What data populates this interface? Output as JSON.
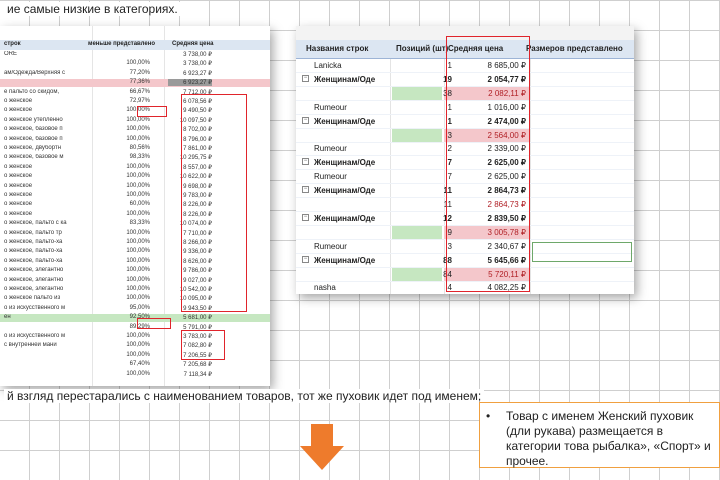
{
  "top_text": "ие самые низкие в категориях.",
  "left_table": {
    "headers": [
      "строк",
      "меньше представлено",
      "Средняя цена"
    ],
    "rows": [
      {
        "name": "ORE",
        "pct": "",
        "price": "3 738,00 ₽"
      },
      {
        "name": "",
        "pct": "100,00%",
        "price": "3 738,00 ₽"
      },
      {
        "name": "ам/Одежда/Верхняя с",
        "pct": "77,20%",
        "price": "6 923,27 ₽"
      },
      {
        "name": "",
        "pct": "77,36%",
        "price": "6 923,27 ₽"
      },
      {
        "name": "е пальто со скидом,",
        "pct": "66,67%",
        "price": "7 712,00 ₽"
      },
      {
        "name": "о женское",
        "pct": "72,97%",
        "price": "6 078,56 ₽"
      },
      {
        "name": "о женское",
        "pct": "100,00%",
        "price": "9 490,50 ₽"
      },
      {
        "name": "о женское утеплённо",
        "pct": "100,00%",
        "price": "10 097,50 ₽"
      },
      {
        "name": "о женское, базовое п",
        "pct": "100,00%",
        "price": "8 702,00 ₽"
      },
      {
        "name": "о женское, базовое п",
        "pct": "100,00%",
        "price": "8 796,00 ₽"
      },
      {
        "name": "о женское, двубортн",
        "pct": "80,56%",
        "price": "7 861,00 ₽"
      },
      {
        "name": "о женское, базовое м",
        "pct": "98,33%",
        "price": "10 295,75 ₽"
      },
      {
        "name": "о женское",
        "pct": "100,00%",
        "price": "8 557,00 ₽"
      },
      {
        "name": "о женское",
        "pct": "100,00%",
        "price": "10 622,00 ₽"
      },
      {
        "name": "о женское",
        "pct": "100,00%",
        "price": "9 698,00 ₽"
      },
      {
        "name": "о женское",
        "pct": "100,00%",
        "price": "9 783,00 ₽"
      },
      {
        "name": "о женское",
        "pct": "60,00%",
        "price": "8 226,00 ₽"
      },
      {
        "name": "о женское",
        "pct": "100,00%",
        "price": "8 226,00 ₽"
      },
      {
        "name": "о женское, пальто с ка",
        "pct": "83,33%",
        "price": "10 074,00 ₽"
      },
      {
        "name": "о женское, пальто тр",
        "pct": "100,00%",
        "price": "7 710,00 ₽"
      },
      {
        "name": "о женское, пальто-ха",
        "pct": "100,00%",
        "price": "8 266,00 ₽"
      },
      {
        "name": "о женское, пальто-ха",
        "pct": "100,00%",
        "price": "9 336,00 ₽"
      },
      {
        "name": "о женское, пальто-ха",
        "pct": "100,00%",
        "price": "8 626,00 ₽"
      },
      {
        "name": "о женское, элегантно",
        "pct": "100,00%",
        "price": "9 786,00 ₽"
      },
      {
        "name": "о женское, элегантно",
        "pct": "100,00%",
        "price": "9 027,00 ₽"
      },
      {
        "name": "о женское, элегантно",
        "pct": "100,00%",
        "price": "10 542,00 ₽"
      },
      {
        "name": "о женское пальто из",
        "pct": "100,00%",
        "price": "10 095,00 ₽"
      },
      {
        "name": "о из искусственного м",
        "pct": "95,00%",
        "price": "9 943,50 ₽"
      },
      {
        "name": "ен",
        "pct": "92,50%",
        "price": "5 681,00 ₽"
      },
      {
        "name": "",
        "pct": "89,29%",
        "price": "5 791,00 ₽"
      },
      {
        "name": "о из искусственного м",
        "pct": "100,00%",
        "price": "3 783,00 ₽"
      },
      {
        "name": "с внутренней мани",
        "pct": "100,00%",
        "price": "7 082,80 ₽"
      },
      {
        "name": "",
        "pct": "100,00%",
        "price": "7 206,55 ₽"
      },
      {
        "name": "",
        "pct": "67,40%",
        "price": "7 205,68 ₽"
      },
      {
        "name": "",
        "pct": "100,00%",
        "price": "7 118,34 ₽"
      }
    ]
  },
  "right_table": {
    "headers": [
      "Названия строк",
      "Позиций (шт)",
      "Средняя цена",
      "Размеров представлено"
    ],
    "rows": [
      {
        "name": "Lanicka",
        "qty": "1",
        "price": "8 685,00 ₽",
        "bold": false,
        "blur": false
      },
      {
        "name": "Женщинам/Оде",
        "qty": "19",
        "price": "2 054,77 ₽",
        "bold": true,
        "blur": false
      },
      {
        "name": "",
        "qty": "38",
        "price": "2 082,11 ₽",
        "bold": false,
        "blur": true
      },
      {
        "name": "Rumeour",
        "qty": "1",
        "price": "1 016,00 ₽",
        "bold": false,
        "blur": false
      },
      {
        "name": "Женщинам/Оде",
        "qty": "1",
        "price": "2 474,00 ₽",
        "bold": true,
        "blur": false
      },
      {
        "name": "",
        "qty": "3",
        "price": "2 564,00 ₽",
        "bold": false,
        "blur": true
      },
      {
        "name": "Rumeour",
        "qty": "2",
        "price": "2 339,00 ₽",
        "bold": false,
        "blur": false
      },
      {
        "name": "Женщинам/Оде",
        "qty": "7",
        "price": "2 625,00 ₽",
        "bold": true,
        "blur": false
      },
      {
        "name": "Rumeour",
        "qty": "7",
        "price": "2 625,00 ₽",
        "bold": false,
        "blur": false
      },
      {
        "name": "Женщинам/Оде",
        "qty": "11",
        "price": "2 864,73 ₽",
        "bold": true,
        "blur": false
      },
      {
        "name": "",
        "qty": "11",
        "price": "2 864,73 ₽",
        "bold": false,
        "blur": true
      },
      {
        "name": "Женщинам/Оде",
        "qty": "12",
        "price": "2 839,50 ₽",
        "bold": true,
        "blur": false
      },
      {
        "name": "",
        "qty": "9",
        "price": "3 005,78 ₽",
        "bold": false,
        "blur": true
      },
      {
        "name": "Rumeour",
        "qty": "3",
        "price": "2 340,67 ₽",
        "bold": false,
        "blur": false
      },
      {
        "name": "Женщинам/Оде",
        "qty": "88",
        "price": "5 645,66 ₽",
        "bold": true,
        "blur": false
      },
      {
        "name": "",
        "qty": "84",
        "price": "5 720,11 ₽",
        "bold": false,
        "blur": true
      },
      {
        "name": "nasha",
        "qty": "4",
        "price": "4 082,25 ₽",
        "bold": false,
        "blur": false
      }
    ]
  },
  "caption": "й взгляд перестарались с наименованием товаров, тот же пуховик идет под именем;",
  "note": {
    "bullet": "•",
    "text": "Товар с именем Женский пуховик (дли рукава) размещается в категории това рыбалка», «Спорт» и прочее."
  },
  "colors": {
    "highlight_red": "#e0242b",
    "row_pink": "#f4c7cb",
    "row_green": "#c6e7c1",
    "arrow": "#ee7b2c",
    "note_border": "#f0a040"
  }
}
